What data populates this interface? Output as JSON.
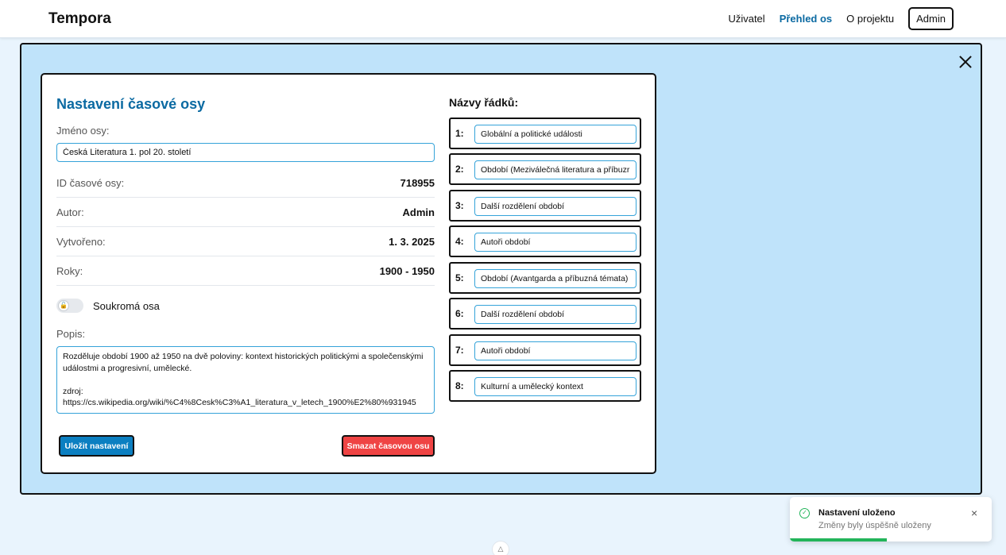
{
  "app": {
    "brand": "Tempora",
    "nav": {
      "user": "Uživatel",
      "overview": "Přehled os",
      "about": "O projektu",
      "admin": "Admin"
    }
  },
  "dialog": {
    "title": "Nastavení časové osy",
    "name_label": "Jméno osy:",
    "name_value": "Česká Literatura 1. pol 20. století",
    "info": [
      {
        "label": "ID časové osy:",
        "value": "718955"
      },
      {
        "label": "Autor:",
        "value": "Admin"
      },
      {
        "label": "Vytvořeno:",
        "value": "1. 3. 2025"
      },
      {
        "label": "Roky:",
        "value": "1900 - 1950"
      }
    ],
    "private_label": "Soukromá osa",
    "private_enabled": false,
    "description_label": "Popis:",
    "description": "Rozděluje období 1900 až 1950 na dvě poloviny: kontext historických politickými a společenskými událostmi a progresivní, umělecké.\n\nzdroj:\nhttps://cs.wikipedia.org/wiki/%C4%8Cesk%C3%A1_literatura_v_letech_1900%E2%80%931945",
    "save_label": "Uložit nastavení",
    "delete_label": "Smazat časovou osu",
    "rows_title": "Názvy řádků:",
    "rows": [
      {
        "num": "1:",
        "value": "Globální a politické události"
      },
      {
        "num": "2:",
        "value": "Období (Meziválečná literatura a příbuzr"
      },
      {
        "num": "3:",
        "value": "Další rozdělení období"
      },
      {
        "num": "4:",
        "value": "Autoři období"
      },
      {
        "num": "5:",
        "value": "Období (Avantgarda a příbuzná témata)"
      },
      {
        "num": "6:",
        "value": "Další rozdělení období"
      },
      {
        "num": "7:",
        "value": "Autoři období"
      },
      {
        "num": "8:",
        "value": "Kulturní a umělecký kontext"
      }
    ]
  },
  "toast": {
    "title": "Nastavení uloženo",
    "message": "Změny byly úspěšně uloženy",
    "close": "×",
    "progress_percent": 48,
    "color": "#22b45a"
  },
  "icons": {
    "success": "check-circle-icon",
    "close": "close-icon",
    "logo": "mountain-icon"
  }
}
